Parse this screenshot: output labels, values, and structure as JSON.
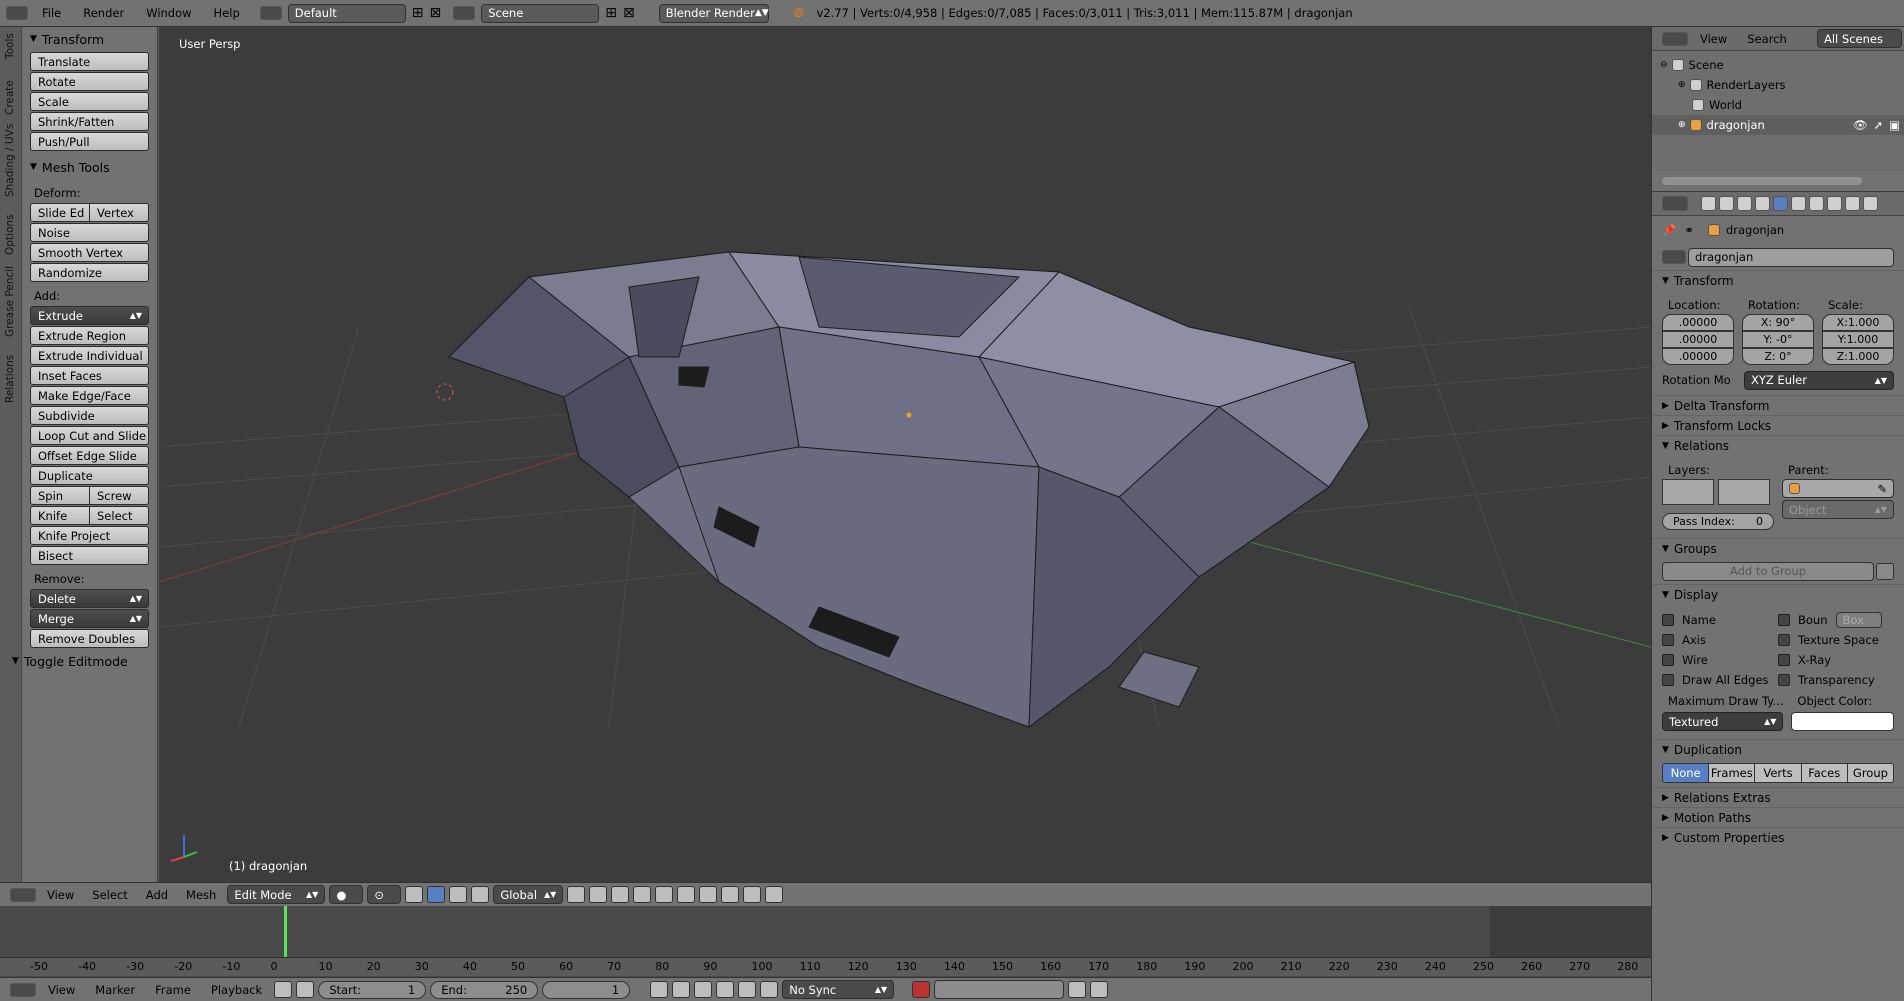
{
  "topbar": {
    "menus": [
      "File",
      "Render",
      "Window",
      "Help"
    ],
    "layout": "Default",
    "scene": "Scene",
    "engine": "Blender Render",
    "stats": "v2.77 | Verts:0/4,958 | Edges:0/7,085 | Faces:0/3,011 | Tris:3,011 | Mem:115.87M | dragonjan"
  },
  "tabs": [
    "Tools",
    "Create",
    "Shading / UVs",
    "Options",
    "Grease Pencil",
    "Relations"
  ],
  "shelf": {
    "transform_title": "Transform",
    "transform_buttons": [
      "Translate",
      "Rotate",
      "Scale",
      "Shrink/Fatten",
      "Push/Pull"
    ],
    "mesh_tools_title": "Mesh Tools",
    "deform_label": "Deform:",
    "slide_edge": "Slide Ed",
    "vertex": "Vertex",
    "deform_buttons": [
      "Noise",
      "Smooth Vertex",
      "Randomize"
    ],
    "add_label": "Add:",
    "extrude": "Extrude",
    "add_buttons": [
      "Extrude Region",
      "Extrude Individual",
      "Inset Faces",
      "Make Edge/Face",
      "Subdivide",
      "Loop Cut and Slide",
      "Offset Edge Slide",
      "Duplicate"
    ],
    "spin": "Spin",
    "screw": "Screw",
    "knife": "Knife",
    "select": "Select",
    "knife_project": "Knife Project",
    "bisect": "Bisect",
    "remove_label": "Remove:",
    "delete": "Delete",
    "merge": "Merge",
    "remove_doubles": "Remove Doubles",
    "toggle_editmode": "Toggle Editmode"
  },
  "viewport": {
    "label": "User Persp",
    "object_label": "(1) dragonjan"
  },
  "vheader": {
    "menus": [
      "View",
      "Select",
      "Add",
      "Mesh"
    ],
    "mode": "Edit Mode",
    "orientation": "Global"
  },
  "timeline": {
    "ticks": [
      "-50",
      "-40",
      "-30",
      "-20",
      "-10",
      "0",
      "10",
      "20",
      "30",
      "40",
      "50",
      "60",
      "70",
      "80",
      "90",
      "100",
      "110",
      "120",
      "130",
      "140",
      "150",
      "160",
      "170",
      "180",
      "190",
      "200",
      "210",
      "220",
      "230",
      "240",
      "250",
      "260",
      "270",
      "280"
    ],
    "current_frame": 0
  },
  "bheader": {
    "menus": [
      "View",
      "Marker",
      "Frame",
      "Playback"
    ],
    "start_label": "Start:",
    "start": "1",
    "end_label": "End:",
    "end": "250",
    "frame": "1",
    "sync": "No Sync"
  },
  "outliner": {
    "menus": [
      "View",
      "Search"
    ],
    "filter": "All Scenes",
    "rows": [
      "Scene",
      "RenderLayers",
      "World",
      "dragonjan"
    ]
  },
  "props": {
    "breadcrumb": "dragonjan",
    "name": "dragonjan",
    "transform_title": "Transform",
    "location_label": "Location:",
    "rotation_label": "Rotation:",
    "scale_label": "Scale:",
    "location": [
      ".00000",
      ".00000",
      ".00000"
    ],
    "rotation": [
      "X:  90°",
      "Y:  -0°",
      "Z:  0°"
    ],
    "scale": [
      "X:1.000",
      "Y:1.000",
      "Z:1.000"
    ],
    "rotation_mode_label": "Rotation Mo",
    "rotation_mode": "XYZ Euler",
    "delta_transform": "Delta Transform",
    "transform_locks": "Transform Locks",
    "relations": "Relations",
    "layers_label": "Layers:",
    "parent_label": "Parent:",
    "parent_type": "Object",
    "pass_index_label": "Pass Index:",
    "pass_index": "0",
    "groups": "Groups",
    "add_to_group": "Add to Group",
    "display": "Display",
    "display_left": [
      "Name",
      "Axis",
      "Wire",
      "Draw All Edges"
    ],
    "display_right_first": "Boun",
    "bounds_type": "Box",
    "display_right": [
      "Texture Space",
      "X-Ray",
      "Transparency"
    ],
    "max_draw_label": "Maximum Draw Ty...",
    "max_draw": "Textured",
    "object_color_label": "Object Color:",
    "object_color": "#ffffff",
    "duplication": "Duplication",
    "dup_options": [
      "None",
      "Frames",
      "Verts",
      "Faces",
      "Group"
    ],
    "relations_extras": "Relations Extras",
    "motion_paths": "Motion Paths",
    "custom_properties": "Custom Properties"
  }
}
